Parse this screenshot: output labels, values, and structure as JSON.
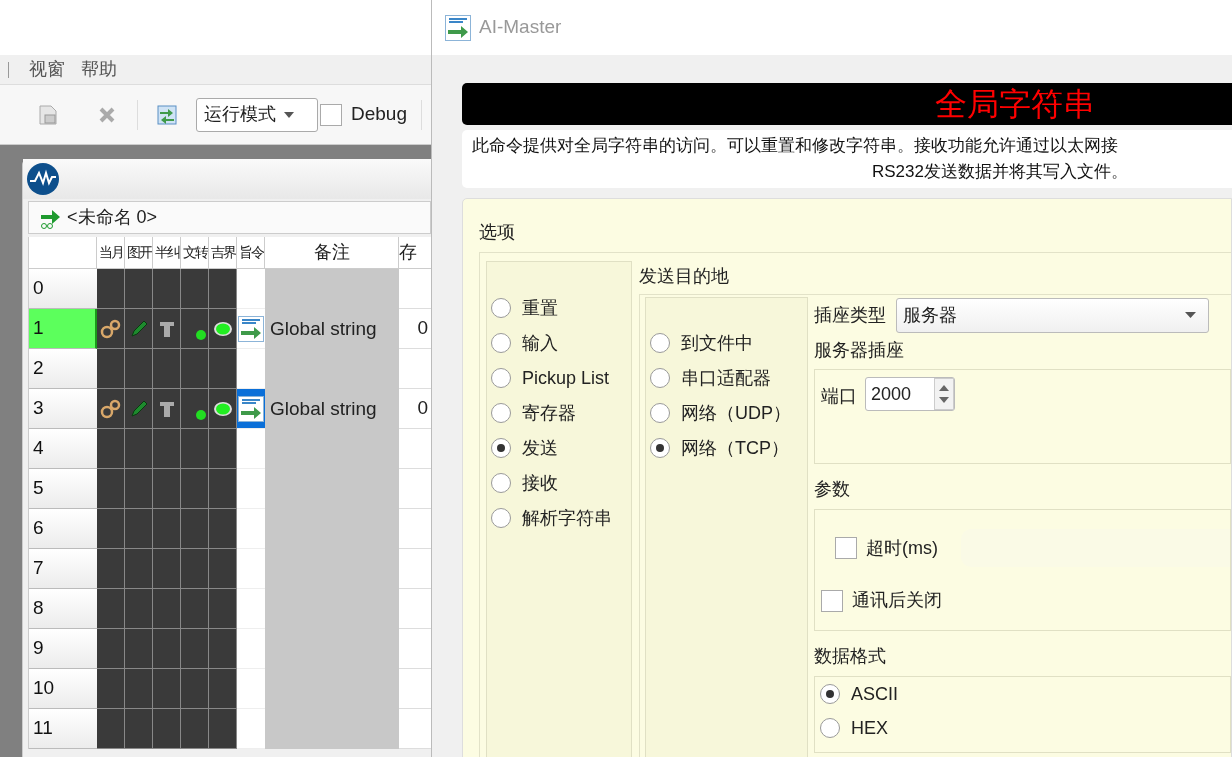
{
  "app": {
    "menu": [
      "视窗",
      "帮助"
    ],
    "toolbar": {
      "mode_select": "运行模式",
      "debug": {
        "label": "Debug",
        "checked": false
      }
    },
    "document": {
      "title": "<未命名 0>",
      "table": {
        "columns": [
          "当月",
          "图开",
          "半纠",
          "文转",
          "吉界",
          "旨令",
          "备注",
          "存"
        ],
        "rows": [
          {
            "index": "0",
            "selected": false,
            "filled": false
          },
          {
            "index": "1",
            "selected": true,
            "filled": true,
            "icon_selected": false,
            "remark": "Global string",
            "value": "0"
          },
          {
            "index": "2",
            "selected": false,
            "filled": false
          },
          {
            "index": "3",
            "selected": false,
            "filled": true,
            "icon_selected": true,
            "remark": "Global string",
            "value": "0"
          },
          {
            "index": "4",
            "selected": false,
            "filled": false
          },
          {
            "index": "5",
            "selected": false,
            "filled": false
          },
          {
            "index": "6",
            "selected": false,
            "filled": false
          },
          {
            "index": "7",
            "selected": false,
            "filled": false
          },
          {
            "index": "8",
            "selected": false,
            "filled": false
          },
          {
            "index": "9",
            "selected": false,
            "filled": false
          },
          {
            "index": "10",
            "selected": false,
            "filled": false
          },
          {
            "index": "11",
            "selected": false,
            "filled": false
          }
        ]
      }
    }
  },
  "dialog": {
    "title": "AI-Master",
    "banner": "全局字符串",
    "description": [
      "此命令提供对全局字符串的访问。可以重置和修改字符串。接收功能允许通过以太网接",
      "RS232发送数据并将其写入文件。"
    ],
    "options": {
      "label": "选项",
      "modes": [
        {
          "label": "重置",
          "selected": false
        },
        {
          "label": "输入",
          "selected": false
        },
        {
          "label": "Pickup List",
          "selected": false
        },
        {
          "label": "寄存器",
          "selected": false
        },
        {
          "label": "发送",
          "selected": true
        },
        {
          "label": "接收",
          "selected": false
        },
        {
          "label": "解析字符串",
          "selected": false
        }
      ],
      "destination": {
        "label": "发送目的地",
        "targets": [
          {
            "label": "到文件中",
            "selected": false
          },
          {
            "label": "串口适配器",
            "selected": false
          },
          {
            "label": "网络（UDP）",
            "selected": false
          },
          {
            "label": "网络（TCP）",
            "selected": true
          }
        ]
      },
      "socket_type": {
        "label": "插座类型",
        "value": "服务器"
      },
      "server_socket": {
        "label": "服务器插座",
        "port_label": "端口",
        "port": "2000"
      },
      "params": {
        "label": "参数",
        "timeout": {
          "label": "超时(ms)",
          "checked": false
        },
        "close_after": {
          "label": "通讯后关闭",
          "checked": false
        }
      },
      "data_format": {
        "label": "数据格式",
        "formats": [
          {
            "label": "ASCII",
            "selected": true
          },
          {
            "label": "HEX",
            "selected": false
          }
        ]
      }
    }
  }
}
